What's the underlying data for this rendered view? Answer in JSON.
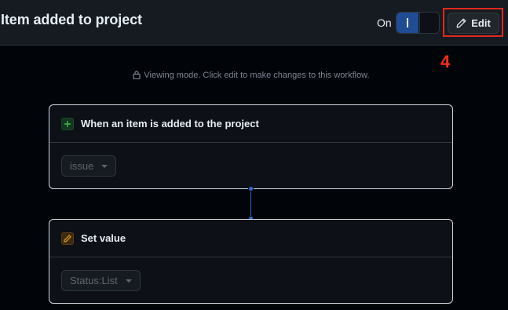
{
  "header": {
    "title": "Item added to project",
    "on_label": "On",
    "toggle_state": "on",
    "edit_label": "Edit",
    "annotation_number": "4"
  },
  "notice": {
    "text": "Viewing mode. Click edit to make changes to this workflow.",
    "icon": "lock-icon"
  },
  "workflow": {
    "trigger": {
      "title": "When an item is added to the project",
      "icon": "plus-icon",
      "select_value": "issue"
    },
    "action": {
      "title": "Set value",
      "icon": "pencil-icon",
      "select_value": "Status:List"
    }
  },
  "colors": {
    "accent": "#2f66d6",
    "annotation": "#e0291b",
    "background": "#010409",
    "header_bg": "#161b22"
  }
}
